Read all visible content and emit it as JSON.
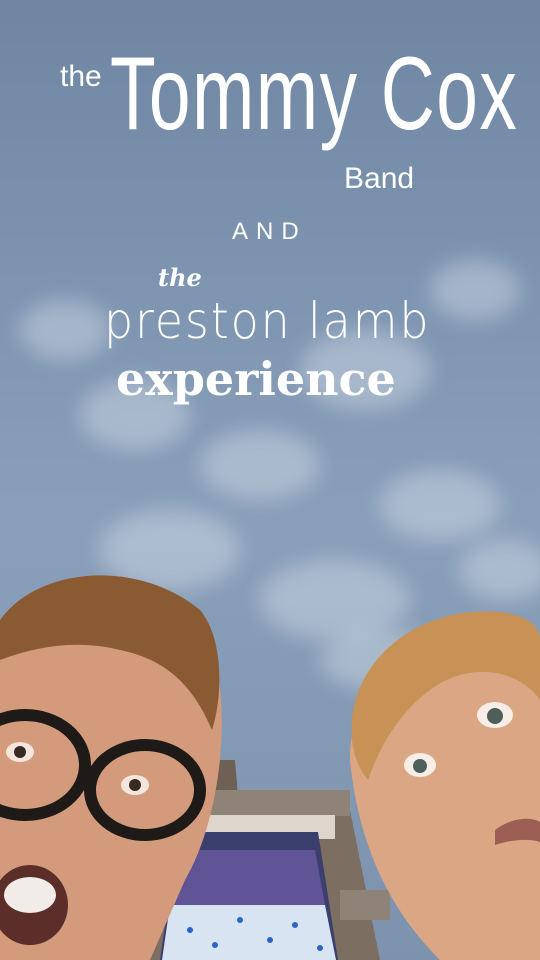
{
  "poster": {
    "line1_small": "the",
    "line1_big": "Tommy Cox",
    "line1_tail": "Band",
    "conjunction": "AND",
    "line2_small": "the",
    "line2_main": "preston lamb",
    "line2_bold": "experience"
  },
  "colors": {
    "sky": "#7e95b1",
    "text": "#ffffff",
    "hair": "#8a5a33",
    "skin": "#d9a17f"
  }
}
